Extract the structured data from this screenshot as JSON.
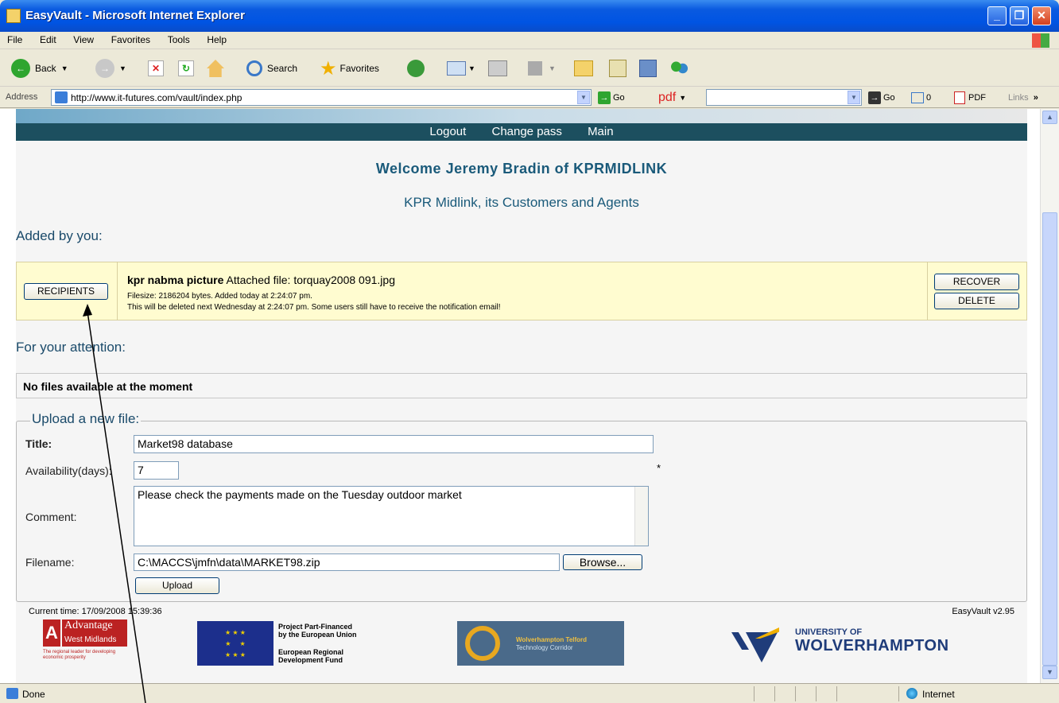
{
  "window": {
    "title": "EasyVault - Microsoft Internet Explorer"
  },
  "menu": [
    "File",
    "Edit",
    "View",
    "Favorites",
    "Tools",
    "Help"
  ],
  "toolbar": {
    "back": "Back",
    "search": "Search",
    "favorites": "Favorites"
  },
  "address": {
    "label": "Address",
    "url": "http://www.it-futures.com/vault/index.php",
    "go": "Go",
    "pdf_search": "pdf",
    "go2": "Go",
    "count": "0",
    "pdf": "PDF",
    "links": "Links"
  },
  "nav": {
    "logout": "Logout",
    "change_pass": "Change pass",
    "main": "Main"
  },
  "welcome": "Welcome Jeremy Bradin of KPRMIDLINK",
  "subtitle": "KPR Midlink, its Customers and Agents",
  "added_by_you": {
    "heading": "Added by you:",
    "recipients_btn": "RECIPIENTS",
    "file_title": "kpr nabma picture",
    "attached": "Attached file: torquay2008 091.jpg",
    "meta1": "Filesize: 2186204 bytes. Added today at 2:24:07 pm.",
    "meta2": "This will be deleted next Wednesday at 2:24:07 pm. Some users still have to receive the notification email!",
    "recover_btn": "RECOVER",
    "delete_btn": "DELETE"
  },
  "attention": {
    "heading": "For your attention:",
    "empty": "No files available at the moment"
  },
  "upload": {
    "legend": "Upload a new file:",
    "title_label": "Title:",
    "title_value": "Market98 database",
    "avail_label": "Availability(days):",
    "avail_value": "7",
    "required_mark": "*",
    "comment_label": "Comment:",
    "comment_value": "Please check the payments made on the Tuesday outdoor market",
    "filename_label": "Filename:",
    "filename_value": "C:\\MACCS\\jmfn\\data\\MARKET98.zip",
    "browse_btn": "Browse...",
    "upload_btn": "Upload"
  },
  "footer": {
    "time": "Current time: 17/09/2008 15:39:36",
    "version": "EasyVault v2.95",
    "advantage": "Advantage",
    "advantage_sub": "West Midlands",
    "advantage_tag": "The regional leader for developing economic prosperity",
    "eu_line1": "Project Part-Financed",
    "eu_line2": "by the European Union",
    "eu_line3": "European Regional",
    "eu_line4": "Development Fund",
    "wtc_line1": "Wolverhampton Telford",
    "wtc_line2": "Technology Corridor",
    "uni_line1": "UNIVERSITY OF",
    "uni_line2": "WOLVERHAMPTON"
  },
  "status": {
    "done": "Done",
    "zone": "Internet"
  },
  "colors": {
    "nav_bg": "#1c4f5f",
    "heading": "#1a5a7a",
    "file_row_bg": "#fffcd0",
    "titlebar": "#0054e3"
  }
}
